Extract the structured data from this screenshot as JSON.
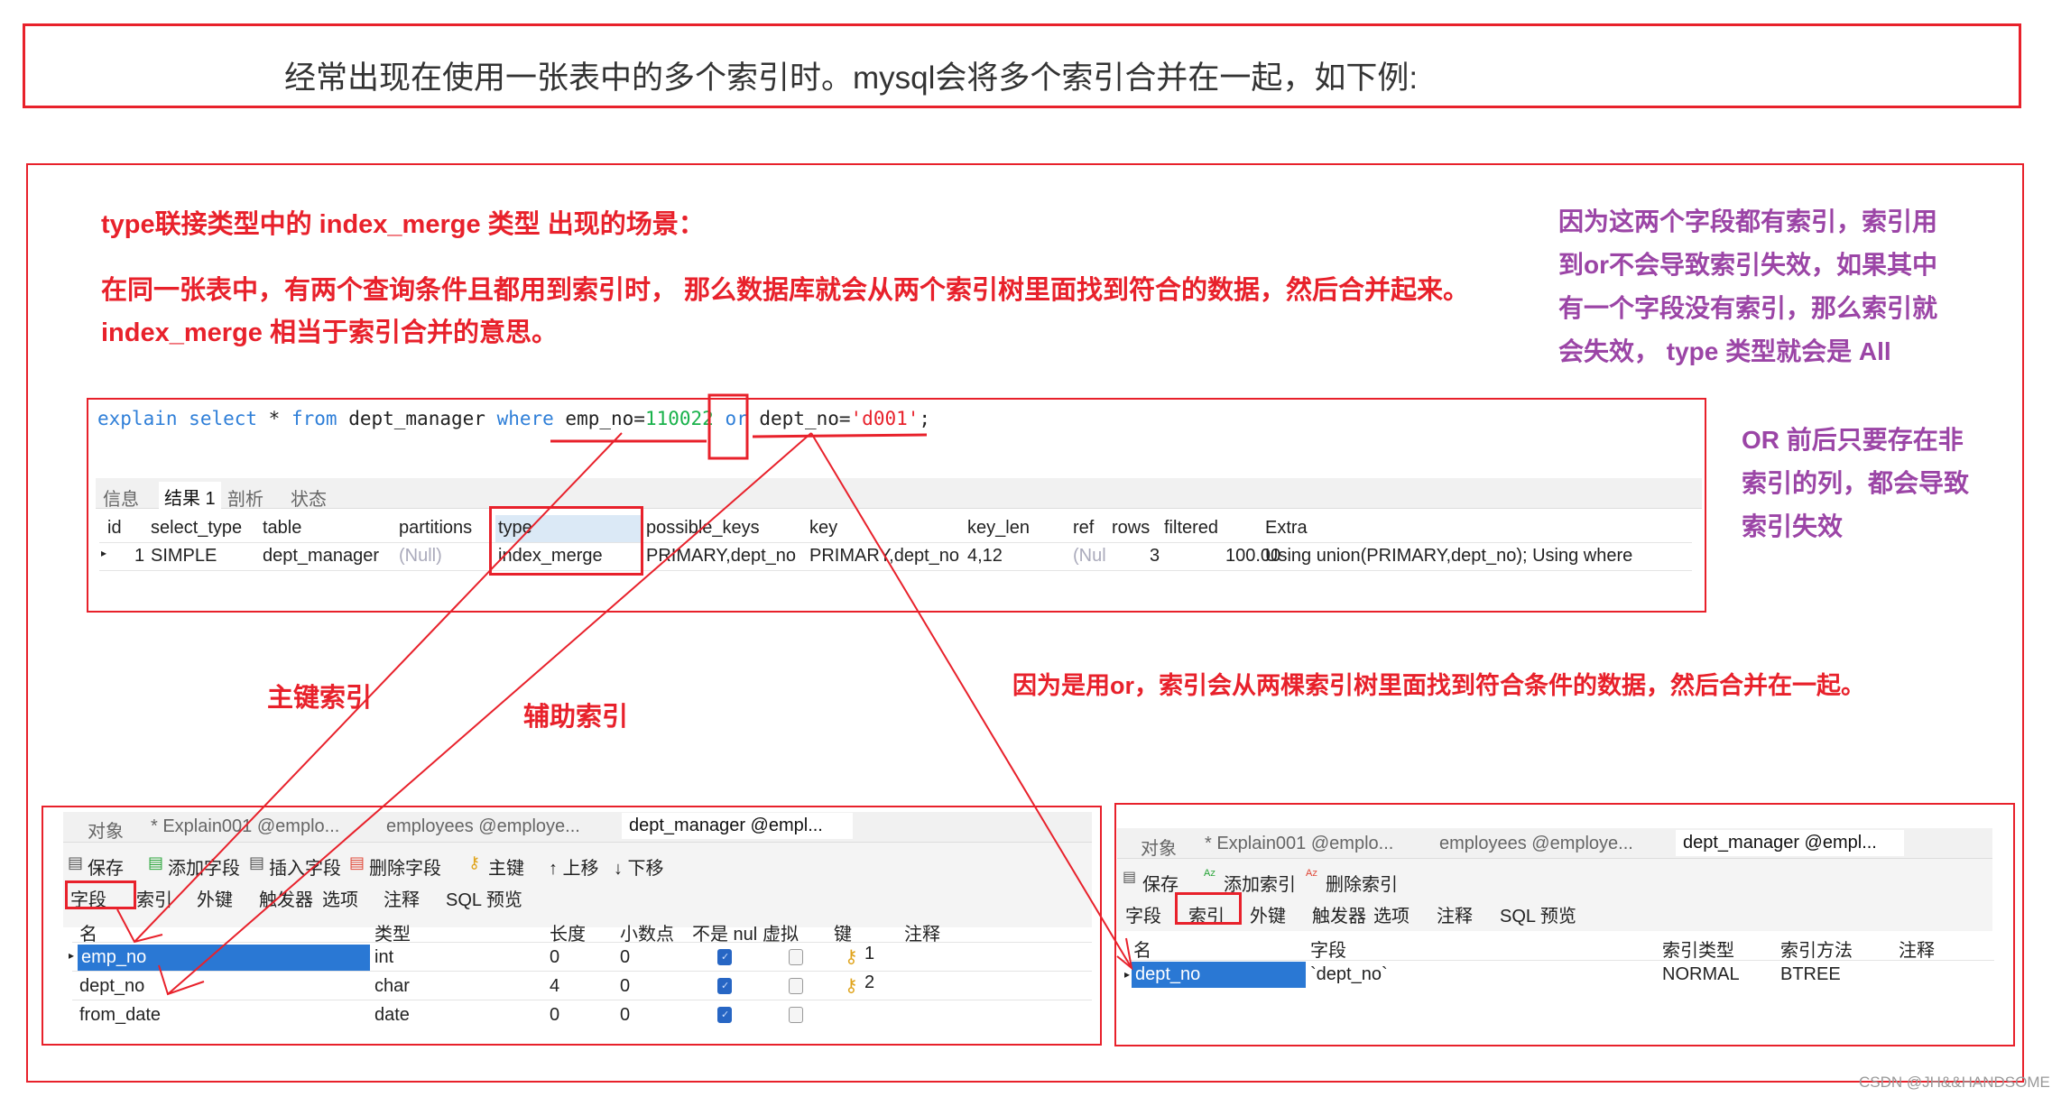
{
  "top_banner": "经常出现在使用一张表中的多个索引时。mysql会将多个索引合并在一起，如下例:",
  "headings": {
    "line1": "type联接类型中的  index_merge 类型 出现的场景：",
    "line2": "在同一张表中，有两个查询条件且都用到索引时， 那么数据库就会从两个索引树里面找到符合的数据，然后合并起来。",
    "line3": "index_merge 相当于索引合并的意思。"
  },
  "side_note": [
    "因为这两个字段都有索引，索引用",
    "到or不会导致索引失效，如果其中",
    "有一个字段没有索引，那么索引就",
    "会失效， type 类型就会是 All"
  ],
  "or_note": [
    "OR 前后只要存在非",
    "索引的列，都会导致",
    "索引失效"
  ],
  "annotations": {
    "primary": "主键索引",
    "secondary": "辅助索引",
    "merge": "因为是用or，索引会从两棵索引树里面找到符合条件的数据，然后合并在一起。"
  },
  "query": {
    "explain": "explain",
    "select": "select",
    "star": " * ",
    "from": "from",
    "table": " dept_manager ",
    "where": "where",
    "col1": " emp_no=",
    "val1": "110022",
    "or": " or ",
    "col2": "dept_no=",
    "val2": "'d001'",
    "end": ";"
  },
  "result_tabs": [
    "信息",
    "结果 1",
    "剖析",
    "状态"
  ],
  "result_columns": [
    "id",
    "select_type",
    "table",
    "partitions",
    "type",
    "possible_keys",
    "key",
    "key_len",
    "ref",
    "rows",
    "filtered",
    "Extra"
  ],
  "result_row": [
    "1",
    "SIMPLE",
    "dept_manager",
    "(Null)",
    "index_merge",
    "PRIMARY,dept_no",
    "PRIMARY,dept_no",
    "4,12",
    "(Nul",
    "3",
    "100.00",
    "Using union(PRIMARY,dept_no); Using where"
  ],
  "left_panel": {
    "tabs": [
      "对象",
      "* Explain001 @emplo...",
      "employees @employe...",
      "dept_manager @empl..."
    ],
    "toolbar": [
      "保存",
      "添加字段",
      "插入字段",
      "删除字段",
      "主键",
      "↑ 上移",
      "↓ 下移"
    ],
    "subtabs": [
      "字段",
      "索引",
      "外键",
      "触发器",
      "选项",
      "注释",
      "SQL 预览"
    ],
    "columns": [
      "名",
      "类型",
      "长度",
      "小数点",
      "不是 nul",
      "虚拟",
      "键",
      "注释"
    ],
    "rows": [
      {
        "name": "emp_no",
        "type": "int",
        "length": "0",
        "decimals": "0",
        "not_null": true,
        "virtual": false,
        "key": "1"
      },
      {
        "name": "dept_no",
        "type": "char",
        "length": "4",
        "decimals": "0",
        "not_null": true,
        "virtual": false,
        "key": "2"
      },
      {
        "name": "from_date",
        "type": "date",
        "length": "0",
        "decimals": "0",
        "not_null": true,
        "virtual": false,
        "key": ""
      }
    ]
  },
  "right_panel": {
    "tabs": [
      "对象",
      "* Explain001 @emplo...",
      "employees @employe...",
      "dept_manager @empl..."
    ],
    "toolbar": [
      "保存",
      "添加索引",
      "删除索引"
    ],
    "subtabs": [
      "字段",
      "索引",
      "外键",
      "触发器",
      "选项",
      "注释",
      "SQL 预览"
    ],
    "columns": [
      "名",
      "字段",
      "索引类型",
      "索引方法",
      "注释"
    ],
    "row": [
      "dept_no",
      "`dept_no`",
      "NORMAL",
      "BTREE",
      ""
    ]
  },
  "watermark": "CSDN @JH&&HANDSOME",
  "colors": {
    "annotation_red": "#e8212b",
    "note_purple": "#9b45a6",
    "selection_blue": "#2a78d4",
    "keyword_blue": "#2f7fd8",
    "number_green": "#19b24b"
  }
}
